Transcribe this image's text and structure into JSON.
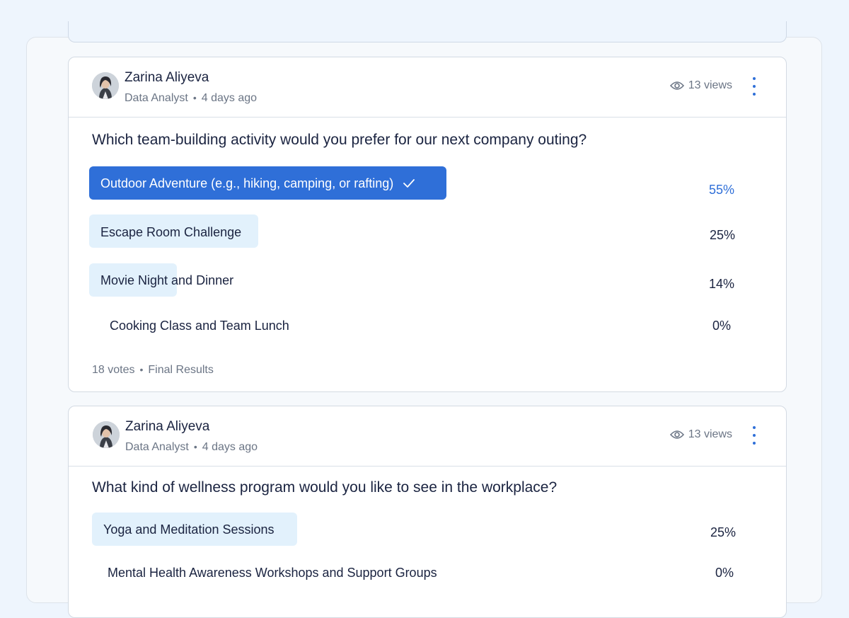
{
  "polls": [
    {
      "author": "Zarina Aliyeva",
      "role": "Data Analyst",
      "time": "4 days ago",
      "views": "13 views",
      "question": "Which team-building activity would you prefer for our next company outing?",
      "options": [
        {
          "label": "Outdoor Adventure (e.g., hiking, camping, or rafting)",
          "percent": "55%",
          "selected": true
        },
        {
          "label": "Escape Room Challenge",
          "percent": "25%",
          "selected": false
        },
        {
          "label": "Movie Night and Dinner",
          "percent": "14%",
          "selected": false
        },
        {
          "label": "Cooking Class and Team Lunch",
          "percent": "0%",
          "selected": false
        }
      ],
      "votes": "18 votes",
      "status": "Final Results"
    },
    {
      "author": "Zarina Aliyeva",
      "role": "Data Analyst",
      "time": "4 days ago",
      "views": "13 views",
      "question": "What kind of wellness program would you like to see in the workplace?",
      "options": [
        {
          "label": "Yoga and Meditation Sessions",
          "percent": "25%",
          "selected": false
        },
        {
          "label": "Mental Health Awareness Workshops and Support Groups",
          "percent": "0%",
          "selected": false
        }
      ]
    }
  ],
  "colors": {
    "accent": "#2f6fd8",
    "fill": "#e2f1fc",
    "selected_fill": "#2f6fd8"
  },
  "icons": {
    "views": "eye-icon",
    "menu": "kebab-menu-icon",
    "selected": "checkmark-icon"
  }
}
